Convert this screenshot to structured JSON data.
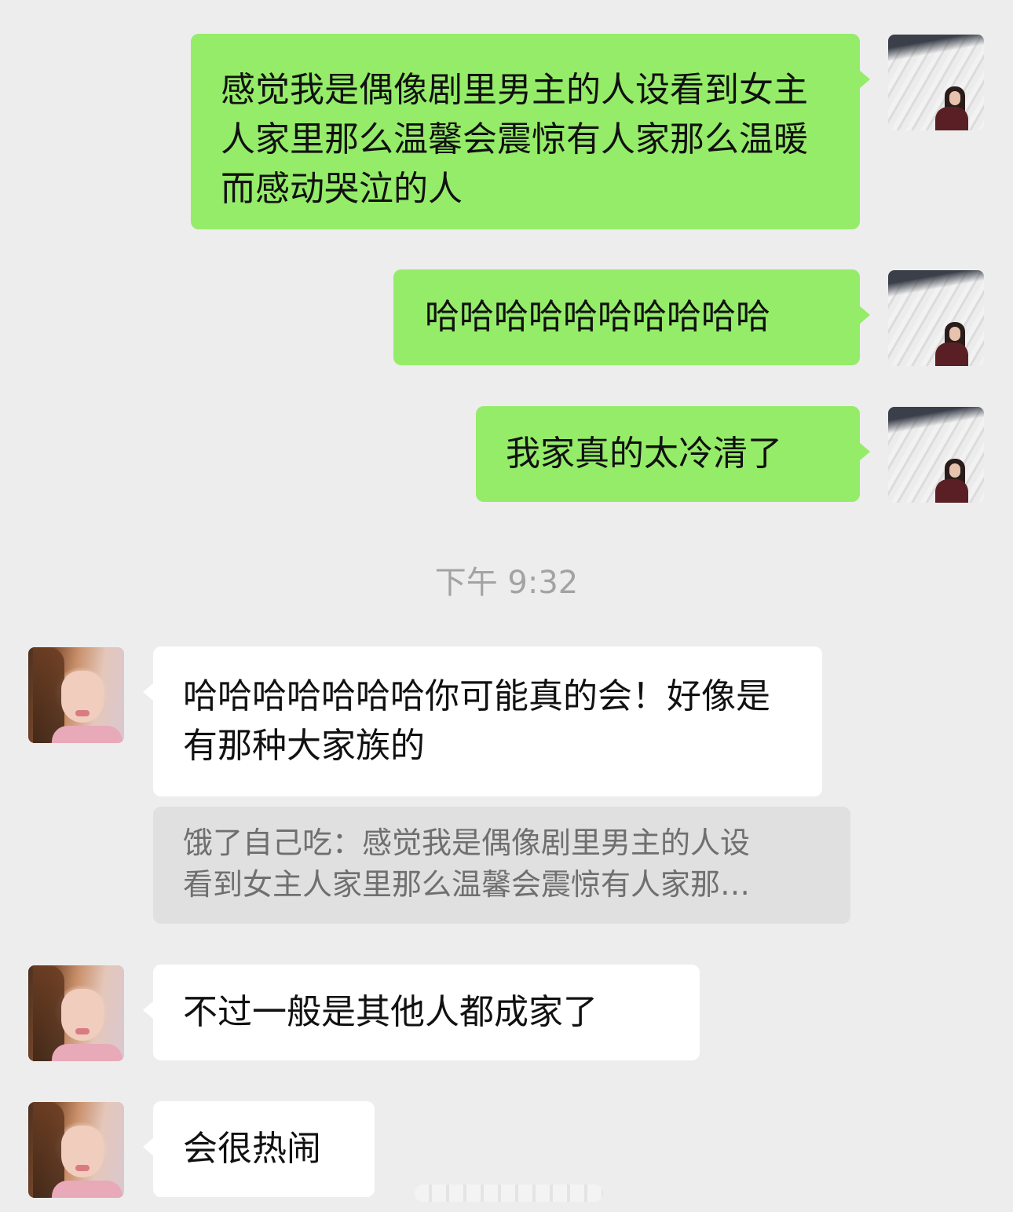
{
  "messages": [
    {
      "side": "me",
      "text": "感觉我是偶像剧里男主的人设看到女主人家里那么温馨会震惊有人家那么温暖而感动哭泣的人"
    },
    {
      "side": "me",
      "text": "哈哈哈哈哈哈哈哈哈哈"
    },
    {
      "side": "me",
      "text": "我家真的太冷清了"
    },
    {
      "side": "her",
      "text": "哈哈哈哈哈哈哈你可能真的会！好像是有那种大家族的"
    },
    {
      "side": "her",
      "text": "不过一般是其他人都成家了"
    },
    {
      "side": "her",
      "text": "会很热闹"
    }
  ],
  "timestamp": "下午 9:32",
  "quote": {
    "line1": "饿了自己吃：感觉我是偶像剧里男主的人设",
    "line2": "看到女主人家里那么温馨会震惊有人家那…"
  },
  "colors": {
    "background": "#ededed",
    "my_bubble": "#95ec69",
    "their_bubble": "#ffffff",
    "quote_bg": "#e0e0e0"
  }
}
